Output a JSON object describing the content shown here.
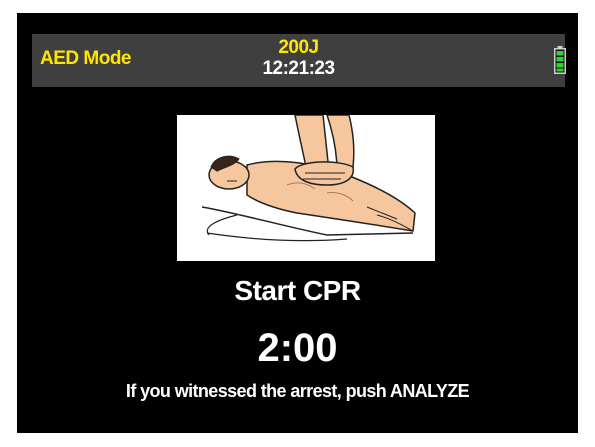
{
  "status": {
    "mode": "AED Mode",
    "energy": "200J",
    "time": "12:21:23",
    "battery_icon": "battery-full-icon",
    "battery_color": "#2bd52b"
  },
  "image": {
    "name": "cpr-illustration"
  },
  "main": {
    "prompt": "Start CPR",
    "timer": "2:00",
    "instruction": "If you witnessed the arrest, push ANALYZE"
  },
  "colors": {
    "background": "#000000",
    "status_bar": "#3f3f3f",
    "accent_yellow": "#ffe600",
    "text": "#ffffff"
  }
}
